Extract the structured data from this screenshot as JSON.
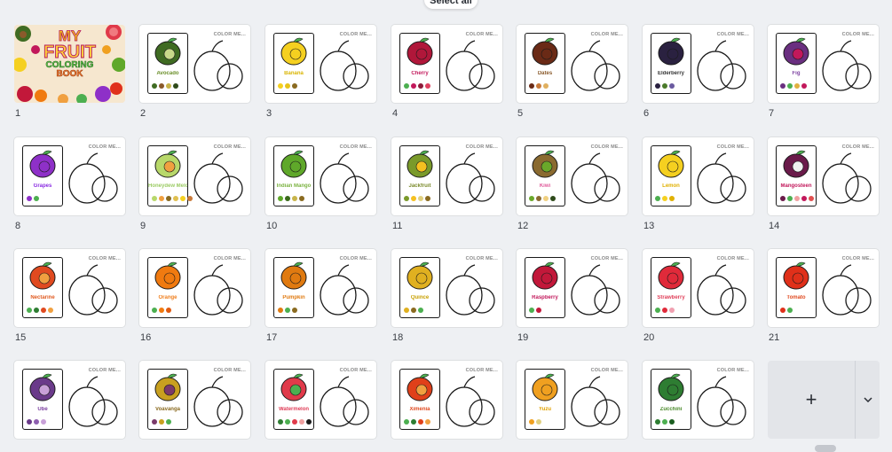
{
  "toolbar": {
    "select_all_label": "Select all"
  },
  "add_panel": {
    "add_label": "+",
    "more_icon": "chevron-down-icon"
  },
  "cover": {
    "number": "1",
    "title_line1": "MY",
    "title_line2": "FRUIT",
    "title_line3": "COLORING",
    "title_line4": "BOOK"
  },
  "sheet_tag": "COLOR ME...",
  "pages": [
    {
      "number": "2",
      "name": "Avocado",
      "label_color": "#6b8f2a",
      "fruit_color": "#3f6b22",
      "inner_color": "#c8d98a",
      "swatches": [
        "#3f6b22",
        "#8a5a2b",
        "#c8b44a",
        "#2e4a1a"
      ]
    },
    {
      "number": "3",
      "name": "Banana",
      "label_color": "#d9b400",
      "fruit_color": "#f5d020",
      "inner_color": "#f5d020",
      "swatches": [
        "#f5d020",
        "#e7c41a",
        "#8a6a20"
      ]
    },
    {
      "number": "4",
      "name": "Cherry",
      "label_color": "#c2185b",
      "fruit_color": "#b0173a",
      "inner_color": "#b0173a",
      "swatches": [
        "#4caf50",
        "#c2185b",
        "#8e1b3a",
        "#e04060"
      ]
    },
    {
      "number": "5",
      "name": "Dates",
      "label_color": "#8a5a2b",
      "fruit_color": "#6a2a16",
      "inner_color": "#6a2a16",
      "swatches": [
        "#6a2a16",
        "#c97a3a",
        "#e0b060"
      ]
    },
    {
      "number": "6",
      "name": "Elderberry",
      "label_color": "#333333",
      "fruit_color": "#2a2140",
      "inner_color": "#2a2140",
      "swatches": [
        "#2a2140",
        "#4a7a2a",
        "#6a5aa0"
      ]
    },
    {
      "number": "7",
      "name": "Fig",
      "label_color": "#7b3fa0",
      "fruit_color": "#6a2f80",
      "inner_color": "#c2185b",
      "swatches": [
        "#6a2f80",
        "#4caf50",
        "#e0b040",
        "#c2185b"
      ]
    },
    {
      "number": "8",
      "name": "Grapes",
      "label_color": "#8a2be2",
      "fruit_color": "#8e30c8",
      "inner_color": "#8e30c8",
      "swatches": [
        "#8e30c8",
        "#4caf50"
      ]
    },
    {
      "number": "9",
      "name": "Honeydew Melon",
      "label_color": "#9ccc65",
      "fruit_color": "#b8d86a",
      "inner_color": "#f0a040",
      "swatches": [
        "#b8d86a",
        "#f0a040",
        "#8a6a20",
        "#e0c050",
        "#f5d020",
        "#c97a3a"
      ]
    },
    {
      "number": "10",
      "name": "Indian Mango",
      "label_color": "#7cb342",
      "fruit_color": "#5fa82a",
      "inner_color": "#5fa82a",
      "swatches": [
        "#5fa82a",
        "#3a6a1a",
        "#c8b44a",
        "#8a6a20"
      ]
    },
    {
      "number": "11",
      "name": "Jackfruit",
      "label_color": "#7a8a2a",
      "fruit_color": "#7a9a2a",
      "inner_color": "#f5c020",
      "swatches": [
        "#7a9a2a",
        "#f5c020",
        "#e0d080",
        "#8a6a20"
      ]
    },
    {
      "number": "12",
      "name": "Kiwi",
      "label_color": "#e05a9a",
      "fruit_color": "#8a6a30",
      "inner_color": "#6aa82a",
      "swatches": [
        "#6aa82a",
        "#8a6a30",
        "#f0d080",
        "#2e4a1a"
      ]
    },
    {
      "number": "13",
      "name": "Lemon",
      "label_color": "#e0b000",
      "fruit_color": "#f5d020",
      "inner_color": "#f5d020",
      "swatches": [
        "#4caf50",
        "#f5d020",
        "#e0b000"
      ]
    },
    {
      "number": "14",
      "name": "Mangosteen",
      "label_color": "#c2185b",
      "fruit_color": "#6a1a4a",
      "inner_color": "#f0f0f0",
      "swatches": [
        "#6a1a4a",
        "#4caf50",
        "#f0a0a0",
        "#c2185b",
        "#e05050"
      ]
    },
    {
      "number": "15",
      "name": "Nectarine",
      "label_color": "#e05a20",
      "fruit_color": "#e04a20",
      "inner_color": "#f0a040",
      "swatches": [
        "#4caf50",
        "#2e7d32",
        "#e04a20",
        "#f0a040"
      ]
    },
    {
      "number": "16",
      "name": "Orange",
      "label_color": "#f08020",
      "fruit_color": "#f07a10",
      "inner_color": "#f07a10",
      "swatches": [
        "#4caf50",
        "#f07a10",
        "#e05a10"
      ]
    },
    {
      "number": "17",
      "name": "Pumpkin",
      "label_color": "#e07a10",
      "fruit_color": "#e07a10",
      "inner_color": "#e07a10",
      "swatches": [
        "#e07a10",
        "#4caf50",
        "#8a6a20"
      ]
    },
    {
      "number": "18",
      "name": "Quince",
      "label_color": "#c8a000",
      "fruit_color": "#e0b020",
      "inner_color": "#e0b020",
      "swatches": [
        "#e0b020",
        "#8a6a20",
        "#4caf50"
      ]
    },
    {
      "number": "19",
      "name": "Raspberry",
      "label_color": "#c2185b",
      "fruit_color": "#c2183a",
      "inner_color": "#c2183a",
      "swatches": [
        "#4caf50",
        "#c2183a"
      ]
    },
    {
      "number": "20",
      "name": "Strawberry",
      "label_color": "#e0405a",
      "fruit_color": "#e02a3a",
      "inner_color": "#e02a3a",
      "swatches": [
        "#4caf50",
        "#e02a3a",
        "#f0a0b0"
      ]
    },
    {
      "number": "21",
      "name": "Tomato",
      "label_color": "#e04a20",
      "fruit_color": "#e0301a",
      "inner_color": "#e0301a",
      "swatches": [
        "#e0301a",
        "#4caf50"
      ]
    },
    {
      "number": "",
      "name": "Ube",
      "label_color": "#7b3fa0",
      "fruit_color": "#6a3a8a",
      "inner_color": "#c8a0d8",
      "swatches": [
        "#6a3a8a",
        "#8e60b0",
        "#c8a0d8"
      ]
    },
    {
      "number": "",
      "name": "Voavanga",
      "label_color": "#8a6a20",
      "fruit_color": "#c8a020",
      "inner_color": "#7a3a6a",
      "swatches": [
        "#7a3a6a",
        "#c8a020",
        "#4caf50"
      ]
    },
    {
      "number": "",
      "name": "Watermelon",
      "label_color": "#e0405a",
      "fruit_color": "#e03a4a",
      "inner_color": "#4caf50",
      "swatches": [
        "#2e7d32",
        "#4caf50",
        "#e03a4a",
        "#f0a0a0",
        "#1a1a1a"
      ]
    },
    {
      "number": "",
      "name": "Ximenia",
      "label_color": "#e04a20",
      "fruit_color": "#e0401a",
      "inner_color": "#f0a040",
      "swatches": [
        "#4caf50",
        "#2e7d32",
        "#e0401a",
        "#f0a040"
      ]
    },
    {
      "number": "",
      "name": "Yuzu",
      "label_color": "#e0a000",
      "fruit_color": "#f0a020",
      "inner_color": "#f0a020",
      "swatches": [
        "#f0a020",
        "#e0d080"
      ]
    },
    {
      "number": "",
      "name": "Zucchini",
      "label_color": "#4a8a2a",
      "fruit_color": "#2e7d32",
      "inner_color": "#2e7d32",
      "swatches": [
        "#2e7d32",
        "#4caf50",
        "#1b5e20"
      ]
    }
  ]
}
